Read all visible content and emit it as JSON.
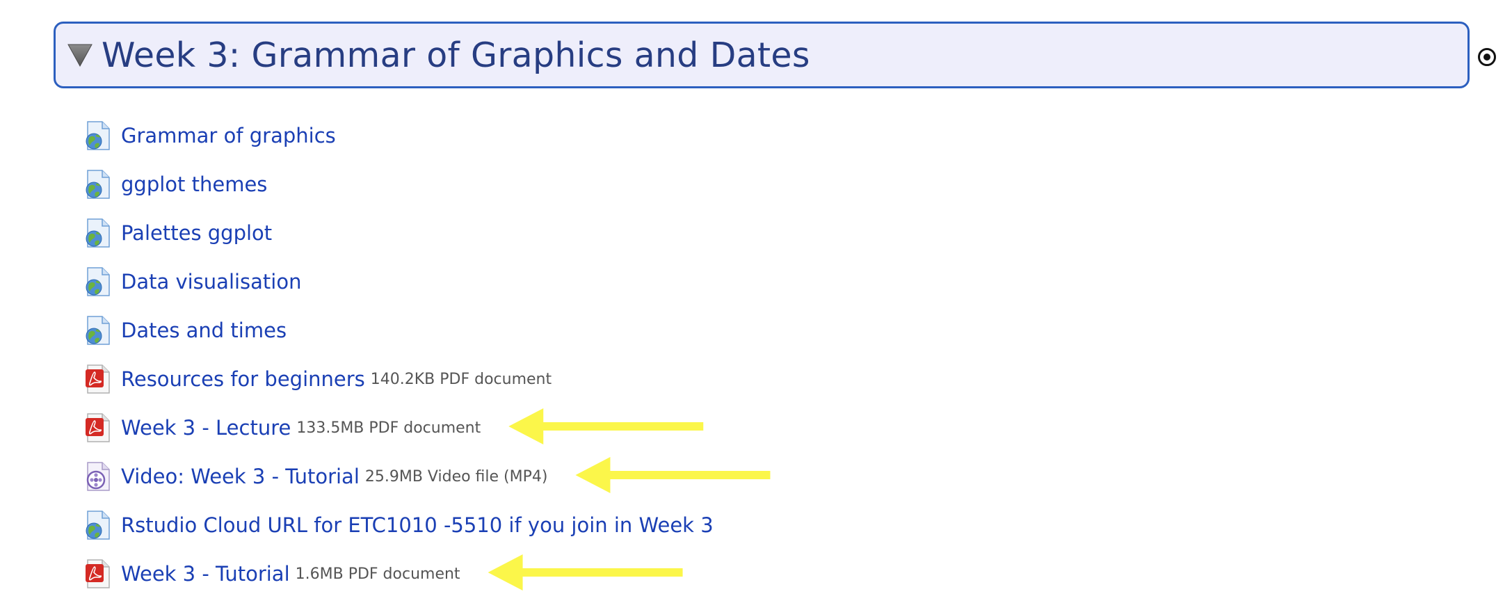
{
  "section": {
    "title": "Week 3: Grammar of Graphics and Dates"
  },
  "activities": [
    {
      "type": "url",
      "icon": "url-globe-icon",
      "name": "Grammar of graphics",
      "info": ""
    },
    {
      "type": "url",
      "icon": "url-globe-icon",
      "name": "ggplot themes",
      "info": ""
    },
    {
      "type": "url",
      "icon": "url-globe-icon",
      "name": "Palettes ggplot",
      "info": ""
    },
    {
      "type": "url",
      "icon": "url-globe-icon",
      "name": "Data visualisation",
      "info": ""
    },
    {
      "type": "url",
      "icon": "url-globe-icon",
      "name": "Dates and times",
      "info": ""
    },
    {
      "type": "pdf",
      "icon": "pdf-icon",
      "name": "Resources for beginners",
      "info": "140.2KB PDF document"
    },
    {
      "type": "pdf",
      "icon": "pdf-icon",
      "name": "Week 3 - Lecture",
      "info": "133.5MB PDF document"
    },
    {
      "type": "video",
      "icon": "video-file-icon",
      "name": "Video: Week 3 - Tutorial",
      "info": "25.9MB Video file (MP4)"
    },
    {
      "type": "url",
      "icon": "url-globe-icon",
      "name": "Rstudio Cloud URL for ETC1010 -5510 if you join in Week 3",
      "info": ""
    },
    {
      "type": "pdf",
      "icon": "pdf-icon",
      "name": "Week 3 - Tutorial",
      "info": "1.6MB PDF document"
    }
  ],
  "annotations": {
    "arrow_color": "#fbf64a",
    "arrows_point_to": [
      "Week 3 - Lecture",
      "Video: Week 3 - Tutorial",
      "Week 3 - Tutorial"
    ]
  },
  "colors": {
    "link": "#1a3fb4",
    "title": "#273d82",
    "header_border": "#2c5fbf",
    "header_bg": "#eeeefb"
  }
}
